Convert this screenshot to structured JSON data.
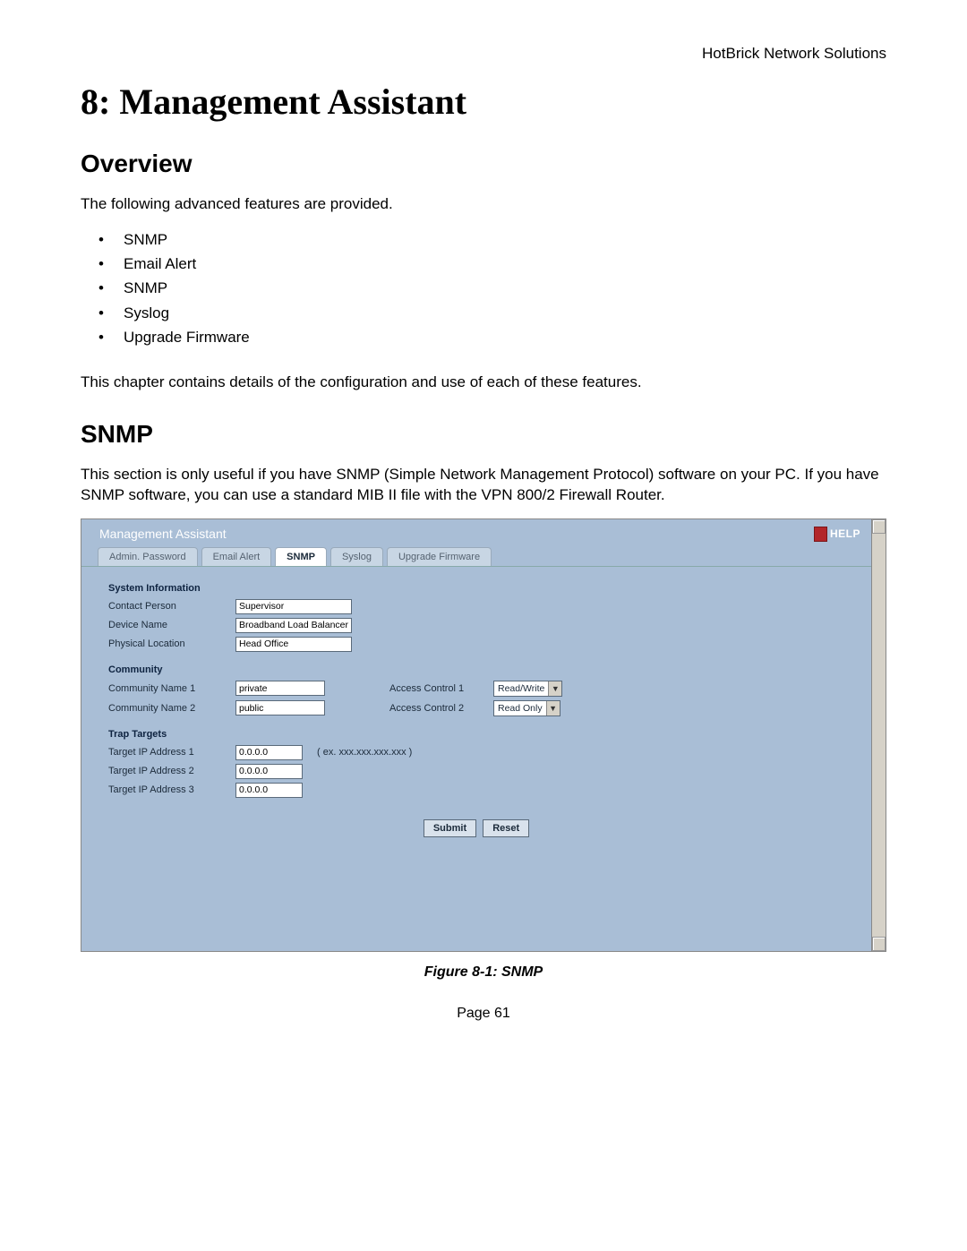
{
  "header": {
    "right": "HotBrick Network Solutions"
  },
  "chapter": {
    "title": "8: Management Assistant"
  },
  "overview": {
    "heading": "Overview",
    "intro": "The following advanced features are provided.",
    "bullets": [
      "SNMP",
      "Email Alert",
      "SNMP",
      "Syslog",
      "Upgrade Firmware"
    ],
    "outro": "This chapter contains details of the configuration and use of each of these features."
  },
  "snmp_section": {
    "heading": "SNMP",
    "para": "This section is only useful if you have SNMP (Simple Network Management Protocol) software on your PC. If you have SNMP software, you can use a standard MIB II file with the VPN 800/2 Firewall Router."
  },
  "screenshot": {
    "title": "Management Assistant",
    "help_label": "HELP",
    "tabs": [
      "Admin. Password",
      "Email Alert",
      "SNMP",
      "Syslog",
      "Upgrade Firmware"
    ],
    "active_tab": "SNMP",
    "groups": {
      "system_info": {
        "title": "System Information",
        "contact_label": "Contact Person",
        "contact_value": "Supervisor",
        "device_label": "Device Name",
        "device_value": "Broadband Load Balancer",
        "location_label": "Physical Location",
        "location_value": "Head Office"
      },
      "community": {
        "title": "Community",
        "name1_label": "Community Name 1",
        "name1_value": "private",
        "ac1_label": "Access Control 1",
        "ac1_value": "Read/Write",
        "name2_label": "Community Name 2",
        "name2_value": "public",
        "ac2_label": "Access Control 2",
        "ac2_value": "Read Only"
      },
      "trap": {
        "title": "Trap Targets",
        "t1_label": "Target IP Address 1",
        "t1_value": "0.0.0.0",
        "t1_hint": "( ex. xxx.xxx.xxx.xxx )",
        "t2_label": "Target IP Address 2",
        "t2_value": "0.0.0.0",
        "t3_label": "Target IP Address 3",
        "t3_value": "0.0.0.0"
      }
    },
    "buttons": {
      "submit": "Submit",
      "reset": "Reset"
    }
  },
  "caption": "Figure 8-1: SNMP",
  "page": "Page 61"
}
